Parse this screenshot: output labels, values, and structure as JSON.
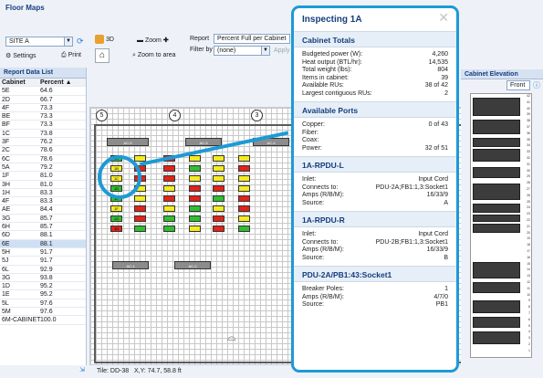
{
  "app": {
    "title": "Floor Maps"
  },
  "toolbar": {
    "site": "SITE A",
    "settings": "Settings",
    "print": "Print",
    "view3d": "3D",
    "zoom": "Zoom",
    "zoom_area": "Zoom to area",
    "report_label": "Report",
    "report_value": "Percent Full per Cabinet",
    "filter_label": "Filter by",
    "filter_value": "(none)",
    "apply": "Apply"
  },
  "report_list": {
    "title": "Report Data List",
    "col1": "Cabinet",
    "col2": "Percent ▲",
    "rows": [
      [
        "5E",
        "64.6"
      ],
      [
        "2D",
        "66.7"
      ],
      [
        "4F",
        "73.3"
      ],
      [
        "BE",
        "73.3"
      ],
      [
        "BF",
        "73.3"
      ],
      [
        "1C",
        "73.8"
      ],
      [
        "3F",
        "76.2"
      ],
      [
        "2C",
        "78.6"
      ],
      [
        "6C",
        "78.6"
      ],
      [
        "5A",
        "79.2"
      ],
      [
        "1F",
        "81.0"
      ],
      [
        "3H",
        "81.0"
      ],
      [
        "1H",
        "83.3"
      ],
      [
        "4F",
        "83.3"
      ],
      [
        "AE",
        "84.4"
      ],
      [
        "3G",
        "85.7"
      ],
      [
        "6H",
        "85.7"
      ],
      [
        "6D",
        "88.1"
      ],
      [
        "6E",
        "88.1"
      ],
      [
        "5H",
        "91.7"
      ],
      [
        "5J",
        "91.7"
      ],
      [
        "6L",
        "92.9"
      ],
      [
        "3G",
        "93.8"
      ],
      [
        "1D",
        "95.2"
      ],
      [
        "1E",
        "95.2"
      ],
      [
        "5L",
        "97.6"
      ],
      [
        "5M",
        "97.6"
      ],
      [
        "6M-CABINET",
        "100.0"
      ]
    ]
  },
  "floorplan": {
    "columns": [
      "5",
      "4",
      "3"
    ],
    "ac_units": [
      "AC-5",
      "AC-3",
      "AC-4",
      "AC-1",
      "AC-2"
    ],
    "rack_labels": [
      "1A",
      "1B",
      "1C",
      "1D",
      "1E",
      "1F",
      "1G",
      "1H"
    ]
  },
  "status": {
    "tile": "Tile: DD-38",
    "xy": "X,Y: 74.7, 58.8 ft"
  },
  "elevation": {
    "title": "Cabinet Elevation",
    "view": "Front",
    "ru": [
      "42",
      "41",
      "40",
      "39",
      "38",
      "37",
      "36",
      "35",
      "34",
      "33",
      "32",
      "31",
      "30",
      "29",
      "28",
      "27",
      "26",
      "25",
      "24",
      "23",
      "22",
      "21",
      "20",
      "19",
      "18",
      "17",
      "16",
      "15",
      "14",
      "13",
      "12",
      "11",
      "10",
      "9",
      "8",
      "7",
      "6",
      "5",
      "4",
      "3",
      "2",
      "1"
    ]
  },
  "popup": {
    "title": "Inspecting 1A",
    "cabinet_totals": {
      "title": "Cabinet Totals",
      "items": [
        [
          "Budgeted power (W):",
          "4,260"
        ],
        [
          "Heat output (BTL/hr):",
          "14,535"
        ],
        [
          "Total weight (lbs):",
          "804"
        ],
        [
          "Items in cabinet:",
          "39"
        ],
        [
          "Available RUs:",
          "38 of 42"
        ],
        [
          "Largest contiguous RUs:",
          "2"
        ]
      ]
    },
    "available_ports": {
      "title": "Available Ports",
      "items": [
        [
          "Copper:",
          "0 of 43"
        ],
        [
          "Fiber:",
          ""
        ],
        [
          "Coax:",
          ""
        ],
        [
          "Power:",
          "32 of 51"
        ]
      ]
    },
    "rpdu_l": {
      "title": "1A-RPDU-L",
      "items": [
        [
          "Inlet:",
          "Input Cord"
        ],
        [
          "Connects to:",
          "PDU-2A;FB1:1,3:Socket1"
        ],
        [
          "Amps (R/B/M):",
          "16/33/9"
        ],
        [
          "Source:",
          "A"
        ]
      ]
    },
    "rpdu_r": {
      "title": "1A-RPDU-R",
      "items": [
        [
          "Inlet:",
          "Input Cord"
        ],
        [
          "Connects to:",
          "PDU-2B;FB1:1,3:Socket1"
        ],
        [
          "Amps (R/B/M):",
          "16/33/9"
        ],
        [
          "Source:",
          "B"
        ]
      ]
    },
    "socket": {
      "title": "PDU-2A/PB1:43:Socket1",
      "items": [
        [
          "Breaker Poles:",
          "1"
        ],
        [
          "Amps (R/B/M):",
          "4/7/0"
        ],
        [
          "Source:",
          "PB1"
        ]
      ]
    }
  },
  "colors": {
    "accent": "#1d9ad6",
    "header": "#153e7e",
    "green": "#2fbf2f",
    "yellow": "#f2ec21",
    "red": "#e2231a"
  }
}
